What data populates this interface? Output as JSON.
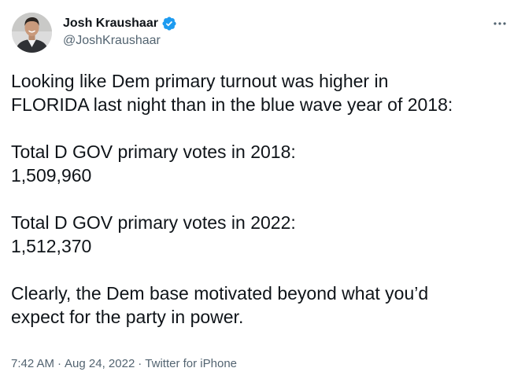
{
  "author": {
    "display_name": "Josh Kraushaar",
    "handle": "@JoshKraushaar",
    "verified": true,
    "avatar_icon": "profile-photo",
    "verified_icon": "verified-badge-icon",
    "verified_color": "#1d9bf0"
  },
  "more_icon": "more-options-icon",
  "tweet": {
    "line1": "Looking like Dem primary turnout was higher in",
    "line2": "FLORIDA last night than in the  blue wave year of 2018:",
    "line3": "Total D GOV primary votes in 2018:",
    "line4": "1,509,960",
    "line5": "Total D GOV primary votes in 2022:",
    "line6": "1,512,370",
    "line7": "Clearly, the Dem base motivated beyond what you’d",
    "line8": "expect for the party in power."
  },
  "meta": {
    "time": "7:42 AM",
    "separator": "·",
    "date": "Aug 24, 2022",
    "source": "Twitter for iPhone"
  },
  "colors": {
    "text": "#0f1419",
    "secondary": "#536471",
    "accent": "#1d9bf0"
  }
}
